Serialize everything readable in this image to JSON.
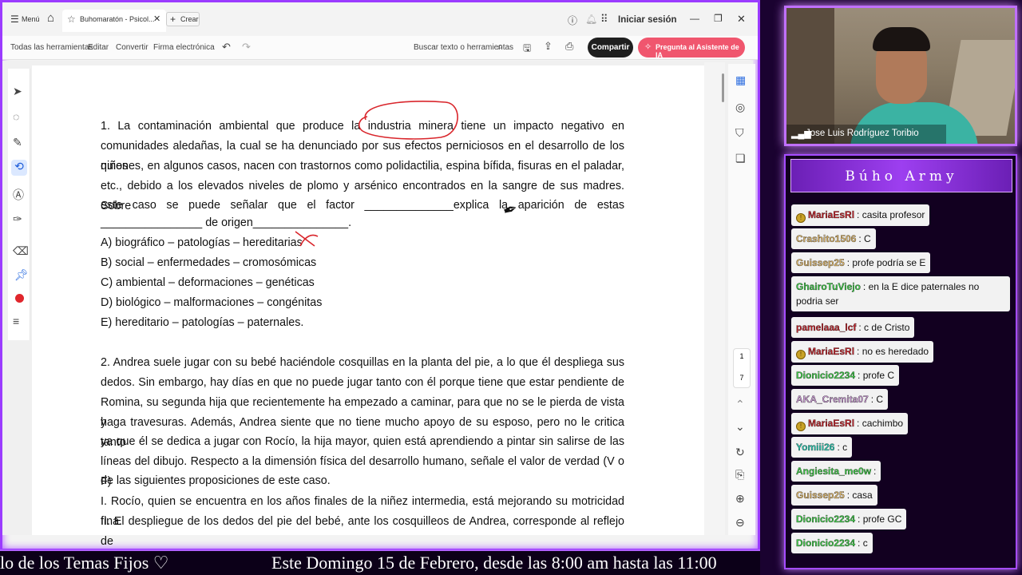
{
  "titlebar": {
    "menu_label": "Menú",
    "tab_title": "Buhomaratón - Psicol...",
    "create_label": "Crear",
    "signin_label": "Iniciar sesión"
  },
  "toolbar": {
    "all_tools": "Todas las herramientas",
    "edit": "Editar",
    "convert": "Convertir",
    "esign": "Firma electrónica",
    "search_placeholder": "Buscar texto o herramientas",
    "share": "Compartir",
    "ai_assistant": "Pregunta al Asistente de IA"
  },
  "document": {
    "q1_lines": [
      "1. La contaminación ambiental que produce la industria minera tiene un impacto negativo en",
      "comunidades aledañas, la cual se ha denunciado por sus efectos perniciosos en el desarrollo de los niños",
      "quienes, en algunos casos, nacen con trastornos como polidactilia, espina bífida, fisuras en el paladar,",
      "etc., debido a los elevados niveles de plomo y arsénico encontrados en la sangre de sus madres. Sobre",
      "este caso se puede señalar que el factor ______________explica la aparición de estas",
      "________________ de origen_______________."
    ],
    "q1_options": [
      "A) biográfico – patologías – hereditarias",
      "B) social – enfermedades – cromosómicas",
      "C) ambiental – deformaciones – genéticas",
      "D) biológico – malformaciones – congénitas",
      "E) hereditario – patologías – paternales."
    ],
    "q2_lines": [
      "2. Andrea suele jugar con su bebé haciéndole cosquillas en la planta del pie, a lo que él despliega sus",
      "dedos. Sin embargo, hay días en que no puede jugar tanto con él porque tiene que estar pendiente de",
      "Romina, su segunda hija que recientemente ha empezado a caminar, para que no se le pierda de vista y",
      "haga travesuras. Además, Andrea siente que no tiene mucho apoyo de su esposo, pero no le critica tanto",
      "ya que él se dedica a jugar con Rocío, la hija mayor, quien está aprendiendo a pintar sin salirse de las",
      "líneas del dibujo. Respecto a la dimensión física del desarrollo humano, señale el valor de verdad (V o F)",
      "de las siguientes proposiciones de este caso.",
      "I. Rocío, quien se encuentra en los años finales de la niñez intermedia, está mejorando su motricidad fina.",
      "II. El despliegue de los dedos del pie del bebé, ante los cosquilleos de Andrea, corresponde al reflejo de"
    ],
    "page_numbers": [
      "1",
      "7"
    ]
  },
  "webcam": {
    "name": "Jose Luis Rodríguez Toribio"
  },
  "chat": {
    "title": "Búho Army",
    "messages": [
      {
        "user": "MariaEsRl",
        "text": ": casita profesor",
        "color": "#c0262d",
        "badge": true
      },
      {
        "user": "Crashito1506",
        "text": ": C",
        "color": "#d9b36a",
        "badge": false
      },
      {
        "user": "Guissep25",
        "text": ": profe podría se E",
        "color": "#d9b36a",
        "badge": false
      },
      {
        "user": "GhairoTuViejo",
        "text": ": en la E dice paternales no",
        "text2": "podria ser",
        "color": "#41c94a",
        "badge": false
      },
      {
        "user": "pamelaaa_lcf",
        "text": ": c de Cristo",
        "color": "#c0262d",
        "badge": false
      },
      {
        "user": "MariaEsRl",
        "text": ": no es heredado",
        "color": "#c0262d",
        "badge": true
      },
      {
        "user": "Dionicio2234",
        "text": ": profe C",
        "color": "#41c94a",
        "badge": false
      },
      {
        "user": "AKA_Cremita07",
        "text": ": C",
        "color": "#c79ad0",
        "badge": false
      },
      {
        "user": "MariaEsRl",
        "text": ": cachimbo",
        "color": "#c0262d",
        "badge": true
      },
      {
        "user": "Yomiii26",
        "text": ": c",
        "color": "#2fc9b2",
        "badge": false
      },
      {
        "user": "Angiesita_me0w",
        "text": ":",
        "color": "#41c94a",
        "badge": false
      },
      {
        "user": "Guissep25",
        "text": ": casa",
        "color": "#d9b36a",
        "badge": false
      },
      {
        "user": "Dionicio2234",
        "text": ": profe GC",
        "color": "#41c94a",
        "badge": false
      },
      {
        "user": "Dionicio2234",
        "text": ": c",
        "color": "#41c94a",
        "badge": false
      }
    ]
  },
  "ticker": {
    "left": "lo de los Temas Fijos ♡",
    "right": "Este Domingo 15 de Febrero, desde las 8:00 am hasta las 11:00"
  },
  "colors": {
    "accent": "#9b3bff",
    "ai_button": "#f0566e",
    "share_button": "#1f1f1f",
    "annotation": "#d9262c"
  }
}
